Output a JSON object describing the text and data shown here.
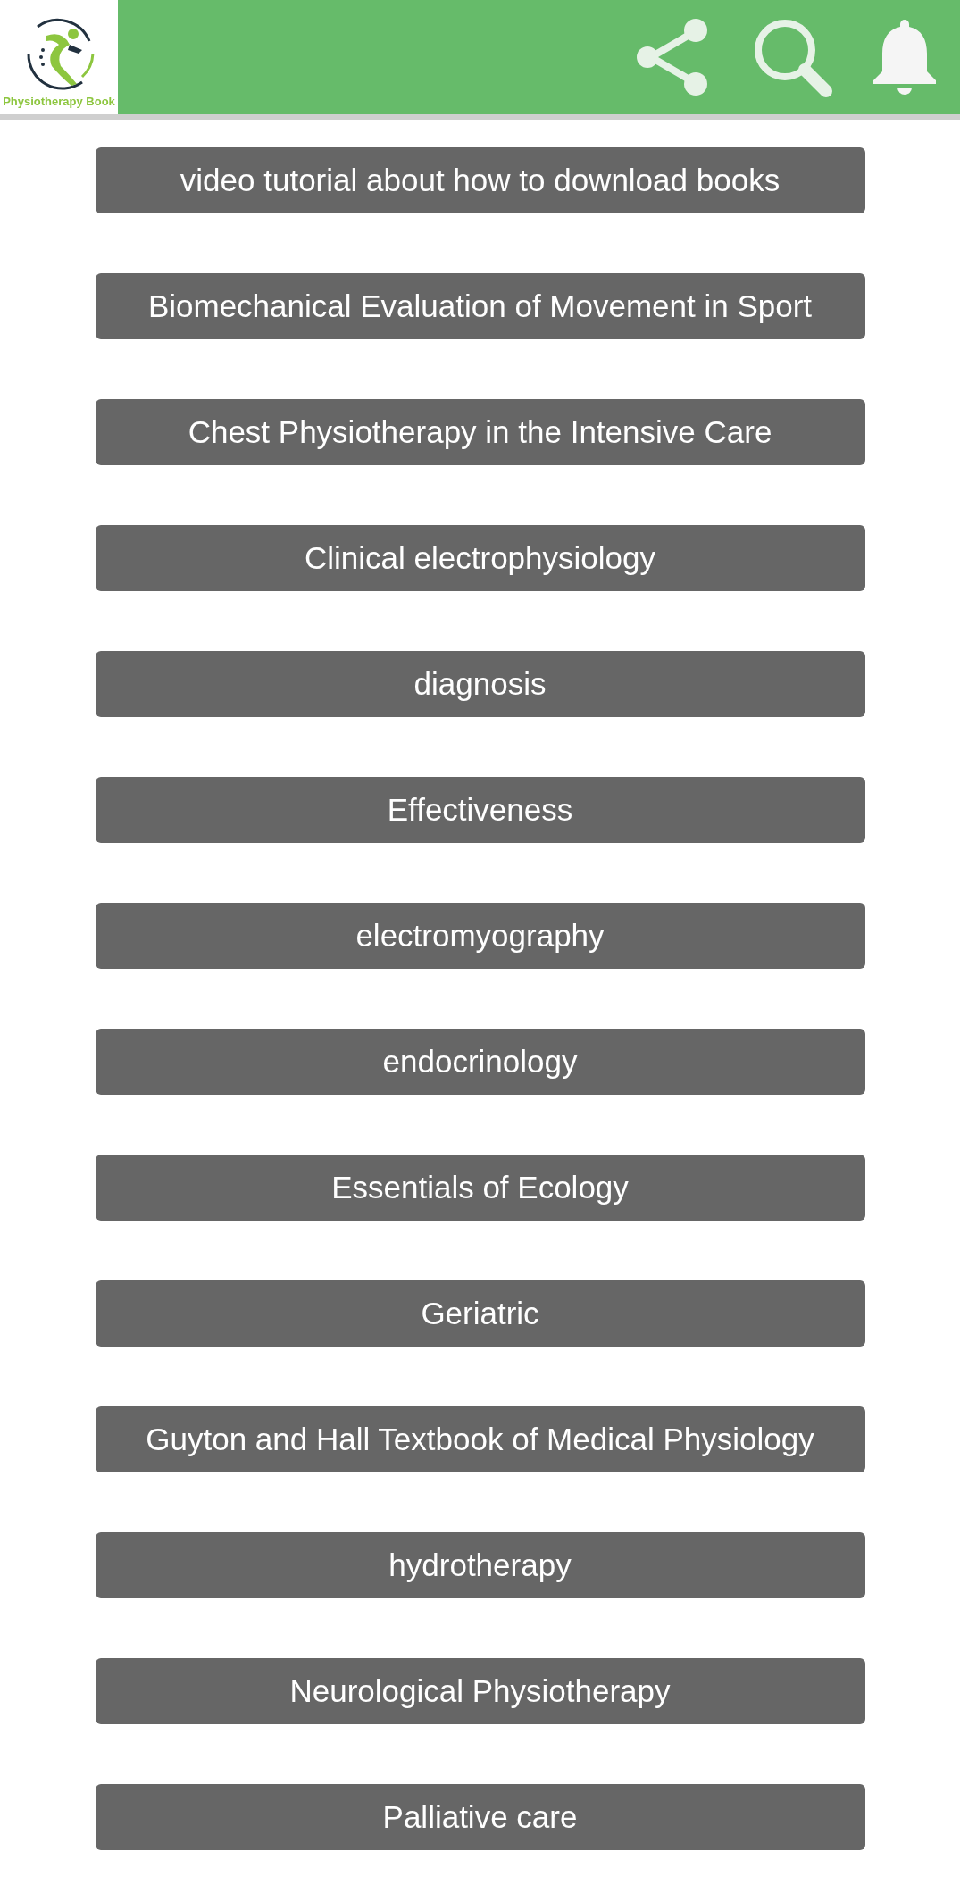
{
  "app_bar": {
    "logo_text": "Physiotherapy Book"
  },
  "books": [
    {
      "title": "video tutorial about how to download books"
    },
    {
      "title": "Biomechanical Evaluation of Movement in Sport"
    },
    {
      "title": "Chest Physiotherapy in the Intensive Care"
    },
    {
      "title": "Clinical electrophysiology"
    },
    {
      "title": "diagnosis"
    },
    {
      "title": "Effectiveness"
    },
    {
      "title": "electromyography"
    },
    {
      "title": "endocrinology"
    },
    {
      "title": "Essentials of Ecology"
    },
    {
      "title": "Geriatric"
    },
    {
      "title": "Guyton and Hall Textbook of Medical Physiology"
    },
    {
      "title": "hydrotherapy"
    },
    {
      "title": "Neurological Physiotherapy"
    },
    {
      "title": "Palliative care"
    }
  ]
}
